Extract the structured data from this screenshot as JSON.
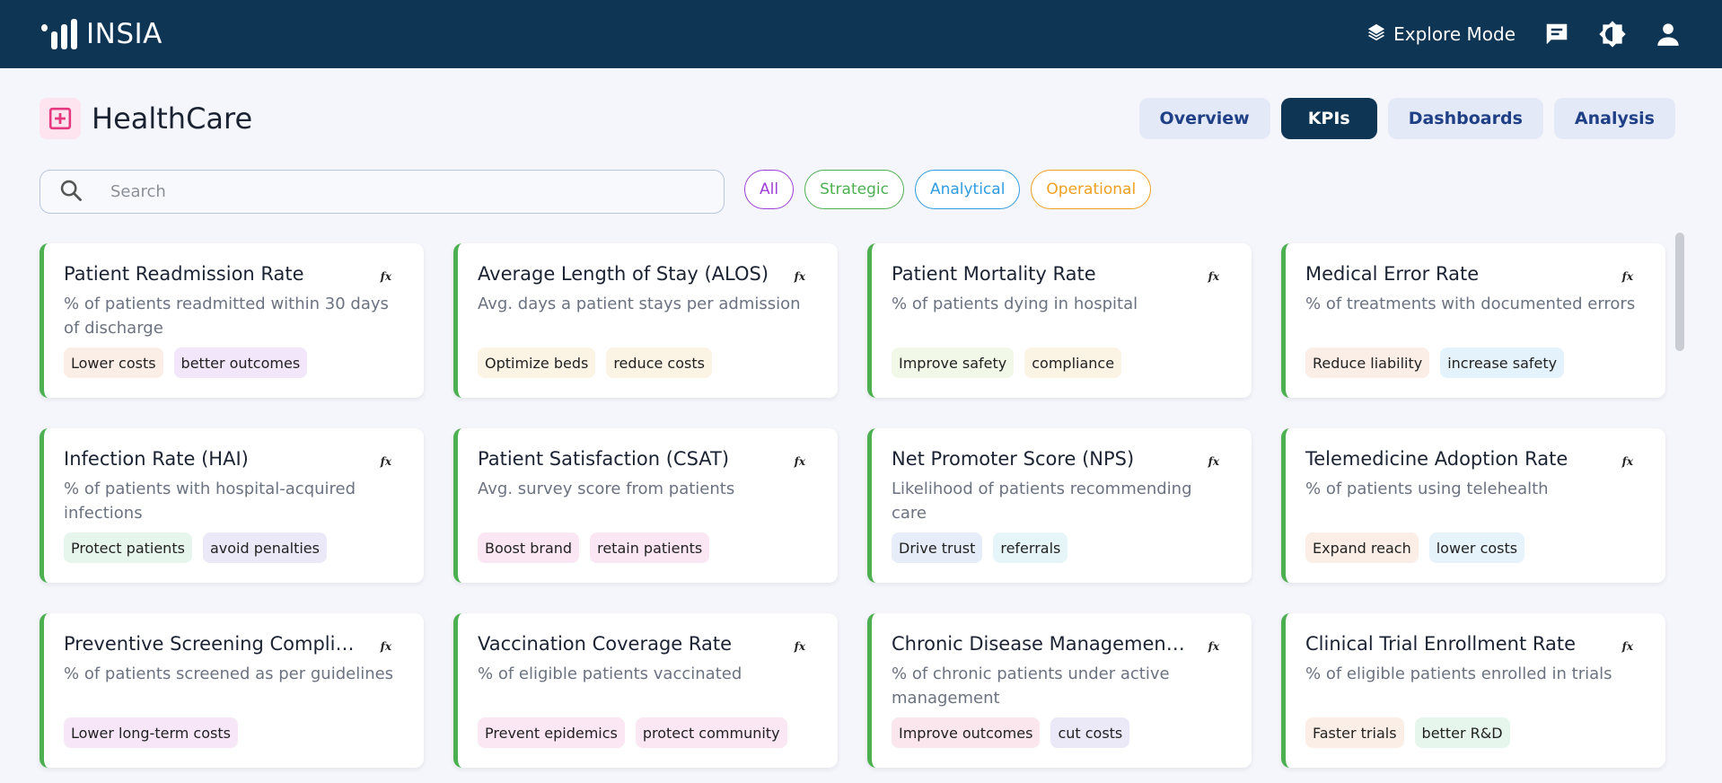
{
  "app": {
    "name": "INSIA"
  },
  "header": {
    "explore_label": "Explore Mode"
  },
  "page": {
    "title": "HealthCare"
  },
  "nav_tabs": [
    {
      "label": "Overview",
      "active": false
    },
    {
      "label": "KPIs",
      "active": true
    },
    {
      "label": "Dashboards",
      "active": false
    },
    {
      "label": "Analysis",
      "active": false
    }
  ],
  "search": {
    "placeholder": "Search",
    "value": ""
  },
  "filters": [
    {
      "label": "All",
      "color": "#9b3fd6"
    },
    {
      "label": "Strategic",
      "color": "#4caf50"
    },
    {
      "label": "Analytical",
      "color": "#2f9be0"
    },
    {
      "label": "Operational",
      "color": "#f0a020"
    }
  ],
  "colors": {
    "topbar": "#0f3554",
    "card_accent": "#4caf50",
    "brand_pink": "#e5397f"
  },
  "icons": {
    "logo": "bar-chart-logo-icon",
    "explore": "layers-icon",
    "chat": "chat-icon",
    "theme": "brightness-icon",
    "user": "user-icon",
    "page": "medical-cross-icon",
    "search": "search-icon",
    "formula": "fx-icon"
  },
  "kpis": [
    {
      "title": "Patient Readmission Rate",
      "desc": "% of patients readmitted within 30 days of discharge",
      "fx": "fx",
      "tags": [
        {
          "label": "Lower costs",
          "bg": "#fbeee6"
        },
        {
          "label": "better outcomes",
          "bg": "#f1e6fa"
        }
      ]
    },
    {
      "title": "Average Length of Stay (ALOS)",
      "desc": "Avg. days a patient stays per admission",
      "fx": "fx",
      "tags": [
        {
          "label": "Optimize beds",
          "bg": "#fbf3e4"
        },
        {
          "label": "reduce costs",
          "bg": "#fbf3e4"
        }
      ]
    },
    {
      "title": "Patient Mortality Rate",
      "desc": "% of patients dying in hospital",
      "fx": "fx",
      "tags": [
        {
          "label": "Improve safety",
          "bg": "#f2f8e8"
        },
        {
          "label": "compliance",
          "bg": "#fbf3e4"
        }
      ]
    },
    {
      "title": "Medical Error Rate",
      "desc": "% of treatments with documented errors",
      "fx": "fx",
      "tags": [
        {
          "label": "Reduce liability",
          "bg": "#fbeee6"
        },
        {
          "label": "increase safety",
          "bg": "#e4f3fb"
        }
      ]
    },
    {
      "title": "Infection Rate (HAI)",
      "desc": "% of patients with hospital-acquired infections",
      "fx": "fx",
      "tags": [
        {
          "label": "Protect patients",
          "bg": "#e6f6ec"
        },
        {
          "label": "avoid penalties",
          "bg": "#ebe8f8"
        }
      ]
    },
    {
      "title": "Patient Satisfaction (CSAT)",
      "desc": "Avg. survey score from patients",
      "fx": "fx",
      "tags": [
        {
          "label": "Boost brand",
          "bg": "#fbe6f3"
        },
        {
          "label": "retain patients",
          "bg": "#fbe6f3"
        }
      ]
    },
    {
      "title": "Net Promoter Score (NPS)",
      "desc": "Likelihood of patients recommending care",
      "fx": "fx",
      "tags": [
        {
          "label": "Drive trust",
          "bg": "#e6ecf8"
        },
        {
          "label": "referrals",
          "bg": "#e6f6f8"
        }
      ]
    },
    {
      "title": "Telemedicine Adoption Rate",
      "desc": "% of patients using telehealth",
      "fx": "fx",
      "tags": [
        {
          "label": "Expand reach",
          "bg": "#fbeee6"
        },
        {
          "label": "lower costs",
          "bg": "#e6f3fb"
        }
      ]
    },
    {
      "title": "Preventive Screening Compliance",
      "desc": "% of patients screened as per guidelines",
      "fx": "fx",
      "tags": [
        {
          "label": "Lower long-term costs",
          "bg": "#f6e6f8"
        }
      ]
    },
    {
      "title": "Vaccination Coverage Rate",
      "desc": "% of eligible patients vaccinated",
      "fx": "fx",
      "tags": [
        {
          "label": "Prevent epidemics",
          "bg": "#fbe6f3"
        },
        {
          "label": "protect community",
          "bg": "#fbe6f3"
        }
      ]
    },
    {
      "title": "Chronic Disease Management Rate",
      "desc": "% of chronic patients under active management",
      "fx": "fx",
      "tags": [
        {
          "label": "Improve outcomes",
          "bg": "#fbe6ee"
        },
        {
          "label": "cut costs",
          "bg": "#ebe8f8"
        }
      ]
    },
    {
      "title": "Clinical Trial Enrollment Rate",
      "desc": "% of eligible patients enrolled in trials",
      "fx": "fx",
      "tags": [
        {
          "label": "Faster trials",
          "bg": "#fbeee6"
        },
        {
          "label": "better R&D",
          "bg": "#e6f6ec"
        }
      ]
    }
  ]
}
